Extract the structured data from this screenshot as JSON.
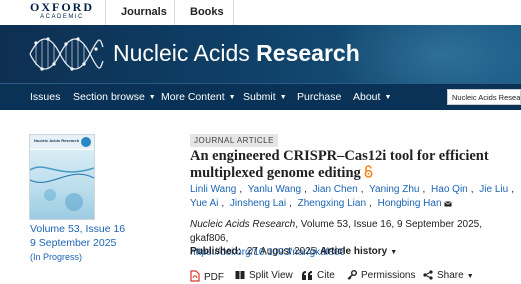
{
  "topbar": {
    "logo_line1": "OXFORD",
    "logo_line2": "ACADEMIC",
    "links": [
      "Journals",
      "Books"
    ]
  },
  "banner": {
    "title_regular": "Nucleic Acids ",
    "title_bold": "Research"
  },
  "nav": {
    "items": [
      "Issues",
      "Section browse",
      "More Content",
      "Submit",
      "Purchase",
      "About"
    ],
    "search_value": "Nucleic Acids Research"
  },
  "issue": {
    "cover_title": "Nucleic Acids Research",
    "volume": "Volume 53, Issue 16",
    "date": "9 September 2025",
    "status": "(In Progress)"
  },
  "article": {
    "type": "JOURNAL ARTICLE",
    "title": "An engineered CRISPR–Cas12i tool for efficient multiplexed genome editing",
    "authors": [
      "Linli Wang",
      "Yanlu Wang",
      "Jian Chen",
      "Yaning Zhu",
      "Hao Qin",
      "Jie Liu",
      "Yue Ai",
      "Jinsheng Lai",
      "Zhengxing Lian",
      "Hongbing Han"
    ],
    "journal": "Nucleic Acids Research",
    "citation_rest": ", Volume 53, Issue 16, 9 September 2025, gkaf806,",
    "doi": "https://doi.org/10.1093/nar/gkaf806",
    "published_label": "Published:",
    "published_date": "27 August 2025",
    "history_label": "Article history"
  },
  "toolbar": {
    "pdf": "PDF",
    "split_view": "Split View",
    "cite": "Cite",
    "permissions": "Permissions",
    "share": "Share"
  },
  "colors": {
    "banner": "#0f3f66",
    "nav": "#093256",
    "link": "#1b64b5",
    "open_access": "#f68212",
    "pdf_icon": "#d9342b"
  },
  "icons": [
    "open-access-icon",
    "mail-icon",
    "pdf-icon",
    "split-view-icon",
    "quote-icon",
    "key-icon",
    "share-icon",
    "caret-down-icon"
  ]
}
